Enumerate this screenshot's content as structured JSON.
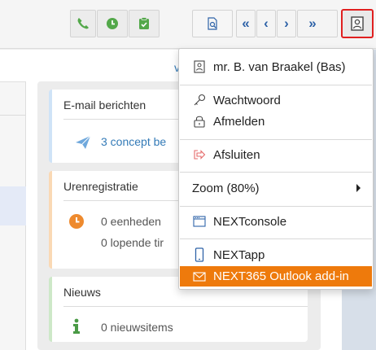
{
  "toolbar": {
    "buttons": [
      {
        "name": "phone-button",
        "icon": "phone-icon"
      },
      {
        "name": "clock-button",
        "icon": "clock-icon"
      },
      {
        "name": "clipboard-button",
        "icon": "clipboard-icon"
      },
      {
        "name": "print-preview-button",
        "icon": "print-preview-icon"
      },
      {
        "name": "first-button",
        "label": "«"
      },
      {
        "name": "prev-button",
        "label": "‹"
      },
      {
        "name": "next-button",
        "label": "›"
      },
      {
        "name": "last-button",
        "label": "»"
      },
      {
        "name": "user-menu-button",
        "icon": "user-card-icon"
      }
    ],
    "colors": {
      "green": "#53a84a",
      "blue": "#2f63a8",
      "highlight_border": "#e02020"
    }
  },
  "background_fragment": "v",
  "widgets": {
    "email": {
      "title": "E-mail berichten",
      "concepts": "3 concept be"
    },
    "uren": {
      "title": "Urenregistratie",
      "units": "0 eenheden",
      "running": "0 lopende tir"
    },
    "news": {
      "title": "Nieuws",
      "items": "0 nieuwsitems"
    }
  },
  "user_menu": {
    "user_name": "mr. B. van Braakel (Bas)",
    "password": "Wachtwoord",
    "logout": "Afmelden",
    "close": "Afsluiten",
    "zoom": "Zoom (80%)",
    "console": "NEXTconsole",
    "app": "NEXTapp",
    "outlook": "NEXT365 Outlook add-in",
    "accent_color": "#ee7a0c"
  }
}
